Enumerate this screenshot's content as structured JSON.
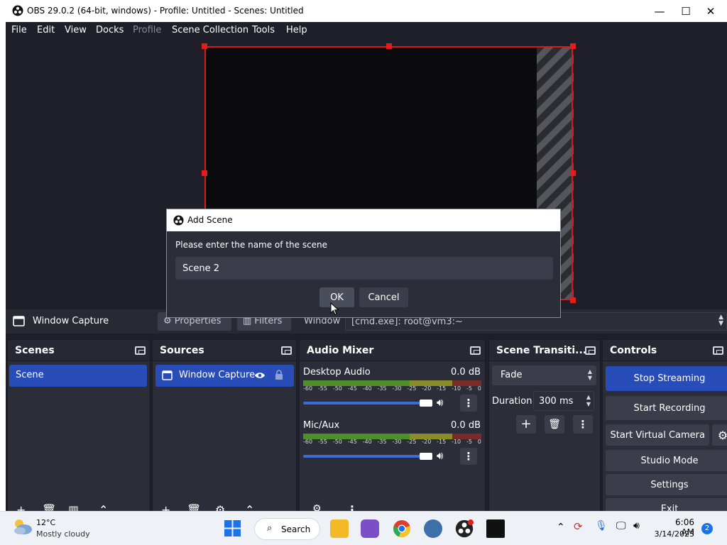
{
  "window": {
    "title": "OBS 29.0.2 (64-bit, windows) - Profile: Untitled - Scenes: Untitled",
    "minimize": "—",
    "maximize": "☐",
    "close": "✕"
  },
  "menu": {
    "items": [
      "File",
      "Edit",
      "View",
      "Docks",
      "Profile",
      "Scene Collection",
      "Tools",
      "Help"
    ],
    "disabled": [
      "Profile"
    ]
  },
  "source_toolbar": {
    "selected_source": "Window Capture",
    "properties": "Properties",
    "filters": "Filters",
    "window_label": "Window",
    "window_value": "[cmd.exe]: root@vm3:~"
  },
  "docks": {
    "scenes": {
      "title": "Scenes",
      "items": [
        "Scene"
      ]
    },
    "sources": {
      "title": "Sources",
      "items": [
        "Window Capture"
      ]
    },
    "audio_mixer": {
      "title": "Audio Mixer",
      "channels": [
        {
          "name": "Desktop Audio",
          "level": "0.0 dB",
          "volume": 1.0
        },
        {
          "name": "Mic/Aux",
          "level": "0.0 dB",
          "volume": 1.0
        }
      ],
      "scale": [
        "-60",
        "-55",
        "-50",
        "-45",
        "-40",
        "-35",
        "-30",
        "-25",
        "-20",
        "-15",
        "-10",
        "-5",
        "0"
      ]
    },
    "transitions": {
      "title": "Scene Transiti...",
      "selected": "Fade",
      "duration_label": "Duration",
      "duration_value": "300 ms"
    },
    "controls": {
      "title": "Controls",
      "stop_streaming": "Stop Streaming",
      "start_recording": "Start Recording",
      "start_virtual_camera": "Start Virtual Camera",
      "studio_mode": "Studio Mode",
      "settings": "Settings",
      "exit": "Exit"
    }
  },
  "dialog": {
    "title": "Add Scene",
    "prompt": "Please enter the name of the scene",
    "input_value": "Scene 2",
    "ok": "OK",
    "cancel": "Cancel"
  },
  "taskbar": {
    "weather_temp": "12°C",
    "weather_desc": "Mostly cloudy",
    "search": "Search",
    "time": "6:06 AM",
    "date": "3/14/2023",
    "notification_count": "2"
  },
  "colors": {
    "accent": "#284cb8",
    "selection_border": "#d51a1a",
    "panel": "#2b2e38",
    "background": "#1e1f29"
  }
}
